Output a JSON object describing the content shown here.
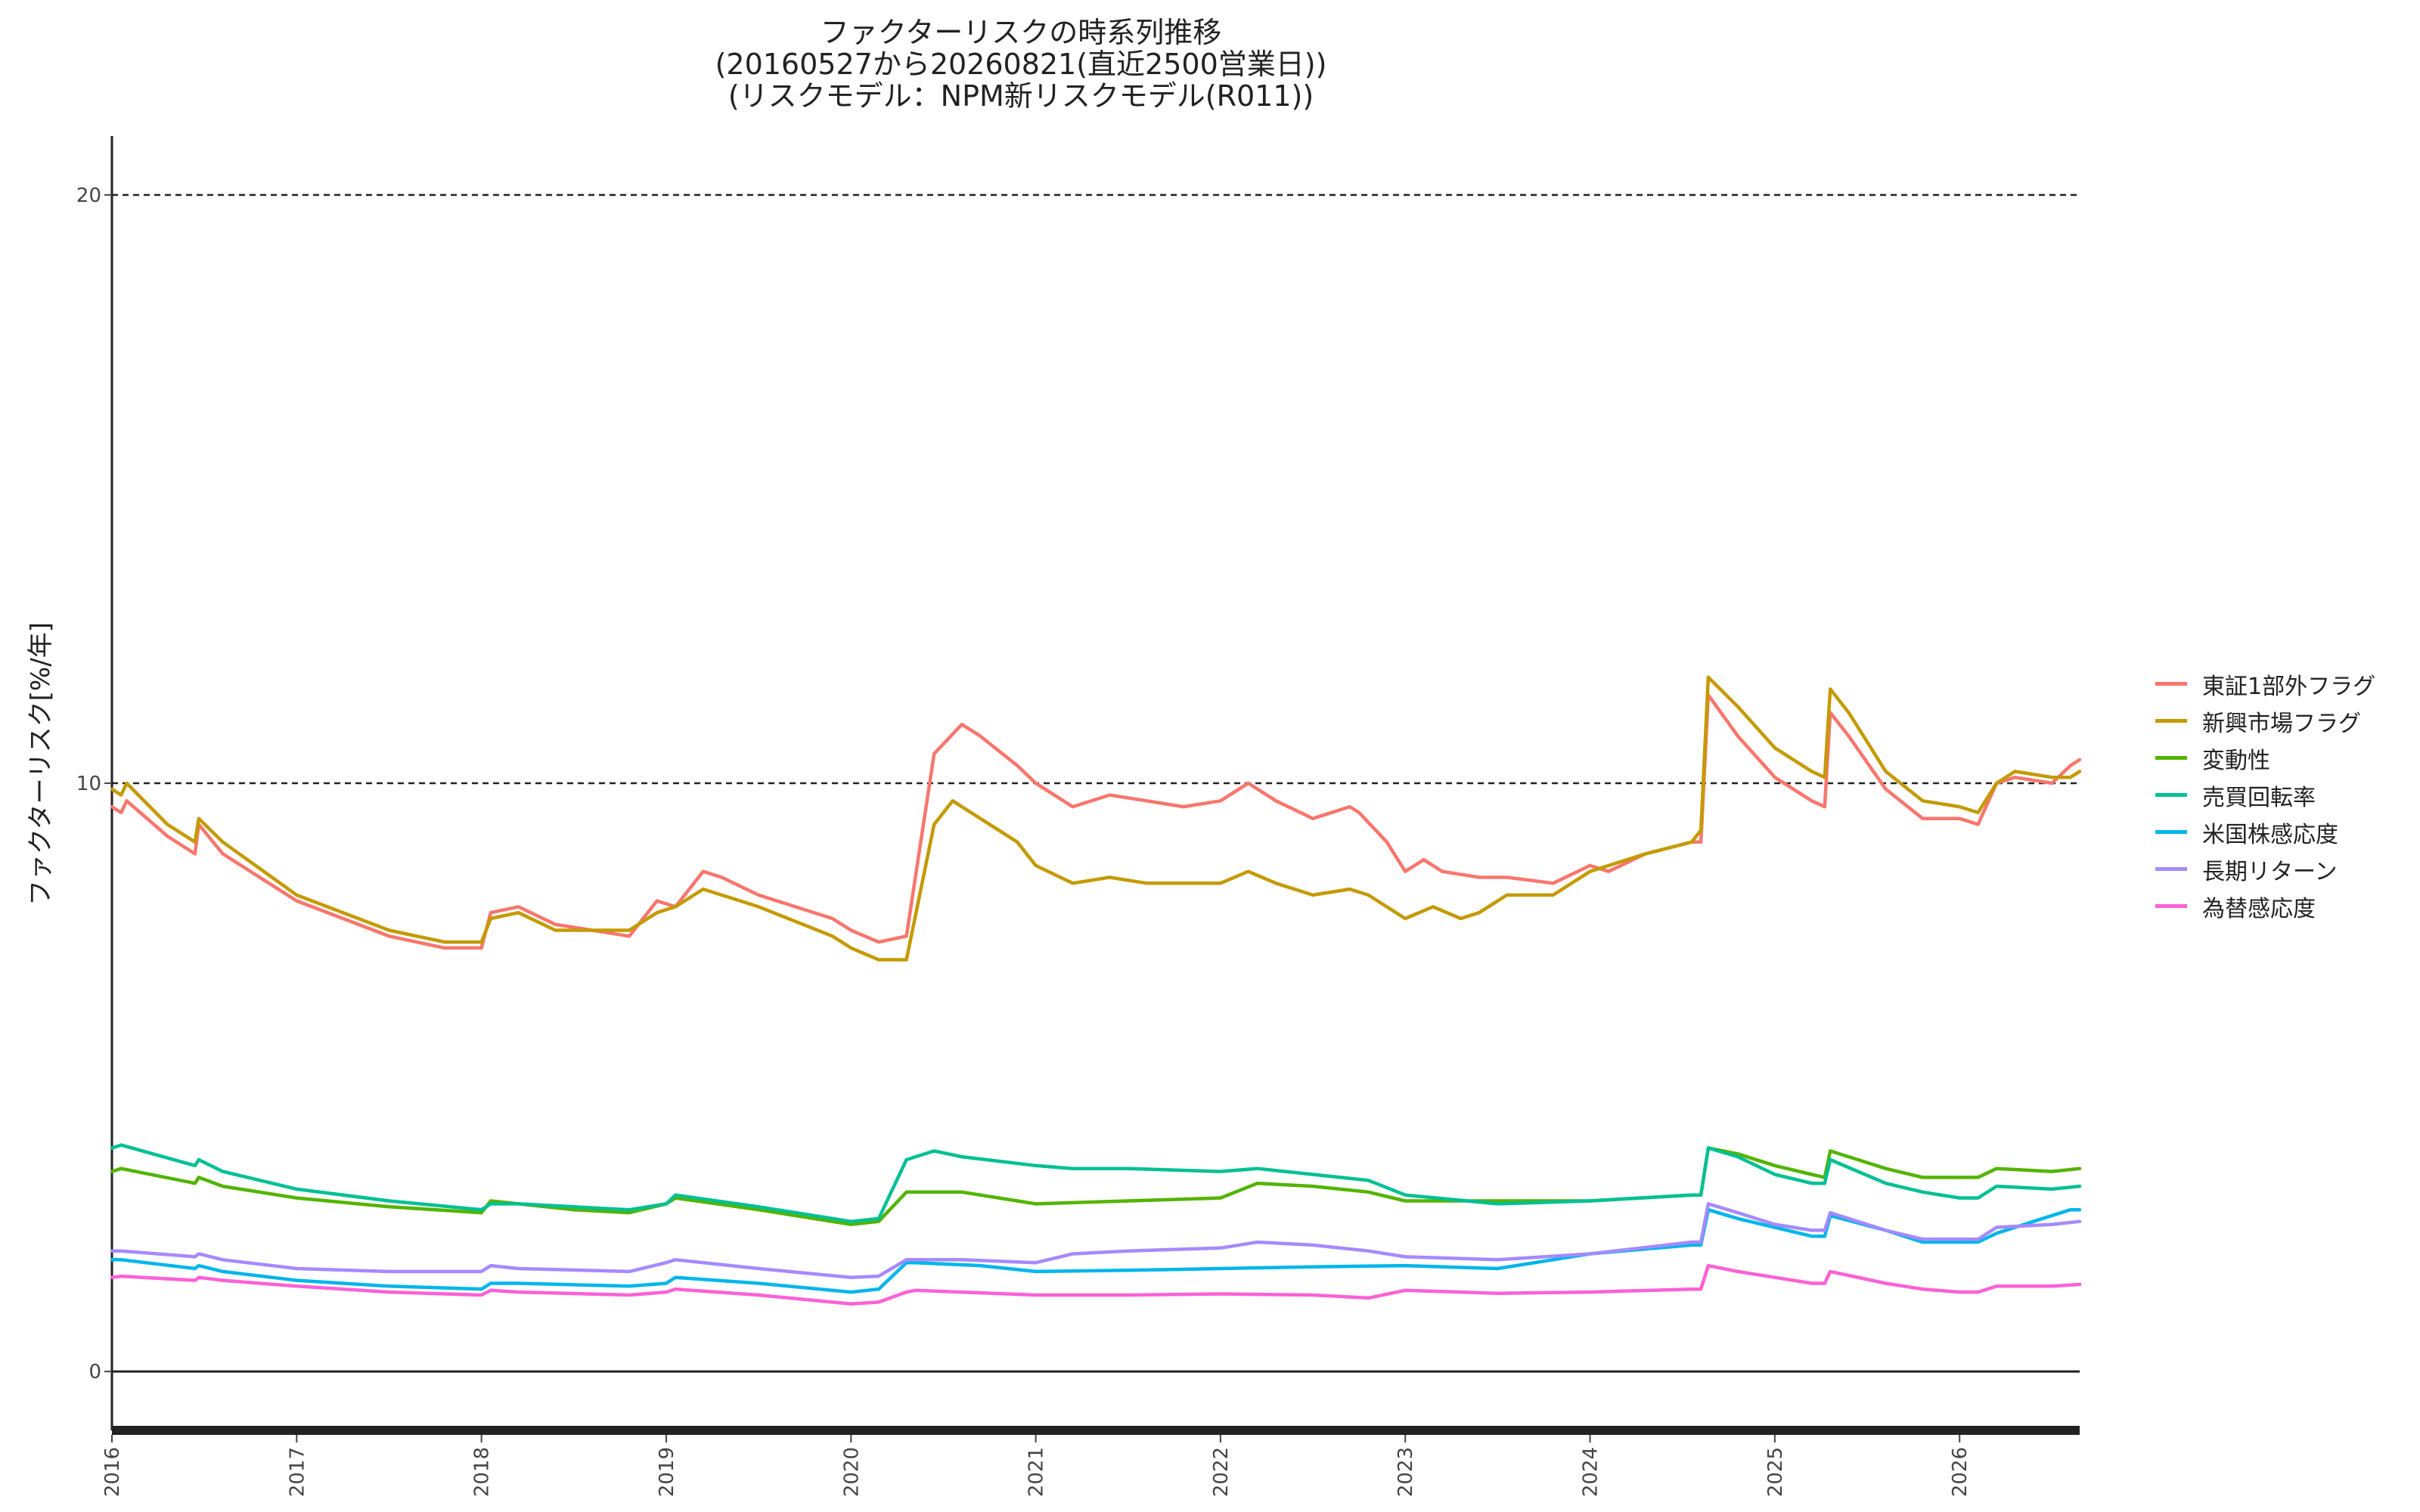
{
  "chart_data": {
    "type": "line",
    "title_lines": [
      "ファクターリスクの時系列推移",
      "(20160527から20260821(直近2500営業日))",
      "(リスクモデル：NPM新リスクモデル(R011))"
    ],
    "ylabel": "ファクターリスク[%/年]",
    "xlabel": "",
    "xlim": [
      2016.0,
      2026.65
    ],
    "ylim": [
      -1.0,
      21.0
    ],
    "x_ticks": [
      "2016",
      "2017",
      "2018",
      "2019",
      "2020",
      "2021",
      "2022",
      "2023",
      "2024",
      "2025",
      "2026"
    ],
    "y_ticks": [
      0,
      10,
      20
    ],
    "reference_lines": [
      10,
      20
    ],
    "legend_position": "right",
    "series": [
      {
        "name": "東証1部外フラグ",
        "color": "#F8766D",
        "x": [
          2016.0,
          2016.05,
          2016.08,
          2016.3,
          2016.45,
          2016.47,
          2016.6,
          2017.0,
          2017.5,
          2017.8,
          2018.0,
          2018.05,
          2018.2,
          2018.4,
          2018.8,
          2018.95,
          2019.05,
          2019.2,
          2019.3,
          2019.5,
          2019.9,
          2020.0,
          2020.15,
          2020.3,
          2020.45,
          2020.6,
          2020.7,
          2020.9,
          2021.0,
          2021.2,
          2021.4,
          2021.6,
          2021.8,
          2022.0,
          2022.15,
          2022.3,
          2022.5,
          2022.7,
          2022.75,
          2022.9,
          2023.0,
          2023.1,
          2023.2,
          2023.4,
          2023.55,
          2023.8,
          2024.0,
          2024.1,
          2024.3,
          2024.55,
          2024.6,
          2024.64,
          2024.8,
          2025.0,
          2025.2,
          2025.27,
          2025.3,
          2025.4,
          2025.6,
          2025.8,
          2026.0,
          2026.1,
          2026.2,
          2026.3,
          2026.5,
          2026.6,
          2026.65
        ],
        "y": [
          9.6,
          9.5,
          9.7,
          9.1,
          8.8,
          9.3,
          8.8,
          8.0,
          7.4,
          7.2,
          7.2,
          7.8,
          7.9,
          7.6,
          7.4,
          8.0,
          7.9,
          8.5,
          8.4,
          8.1,
          7.7,
          7.5,
          7.3,
          7.4,
          10.5,
          11.0,
          10.8,
          10.3,
          10.0,
          9.6,
          9.8,
          9.7,
          9.6,
          9.7,
          10.0,
          9.7,
          9.4,
          9.6,
          9.5,
          9.0,
          8.5,
          8.7,
          8.5,
          8.4,
          8.4,
          8.3,
          8.6,
          8.5,
          8.8,
          9.0,
          9.0,
          11.5,
          10.8,
          10.1,
          9.7,
          9.6,
          11.2,
          10.8,
          9.9,
          9.4,
          9.4,
          9.3,
          10.0,
          10.1,
          10.0,
          10.3,
          10.4
        ]
      },
      {
        "name": "新興市場フラグ",
        "color": "#C49A00",
        "x": [
          2016.0,
          2016.05,
          2016.08,
          2016.3,
          2016.45,
          2016.47,
          2016.6,
          2017.0,
          2017.5,
          2017.8,
          2018.0,
          2018.05,
          2018.2,
          2018.4,
          2018.8,
          2018.95,
          2019.05,
          2019.2,
          2019.5,
          2019.9,
          2020.0,
          2020.15,
          2020.3,
          2020.45,
          2020.55,
          2020.7,
          2020.9,
          2021.0,
          2021.2,
          2021.4,
          2021.6,
          2021.8,
          2022.0,
          2022.15,
          2022.3,
          2022.5,
          2022.7,
          2022.8,
          2023.0,
          2023.15,
          2023.3,
          2023.4,
          2023.55,
          2023.8,
          2024.0,
          2024.3,
          2024.55,
          2024.6,
          2024.64,
          2024.8,
          2025.0,
          2025.2,
          2025.27,
          2025.3,
          2025.4,
          2025.6,
          2025.8,
          2026.0,
          2026.1,
          2026.2,
          2026.3,
          2026.5,
          2026.6,
          2026.65
        ],
        "y": [
          9.9,
          9.8,
          10.0,
          9.3,
          9.0,
          9.4,
          9.0,
          8.1,
          7.5,
          7.3,
          7.3,
          7.7,
          7.8,
          7.5,
          7.5,
          7.8,
          7.9,
          8.2,
          7.9,
          7.4,
          7.2,
          7.0,
          7.0,
          9.3,
          9.7,
          9.4,
          9.0,
          8.6,
          8.3,
          8.4,
          8.3,
          8.3,
          8.3,
          8.5,
          8.3,
          8.1,
          8.2,
          8.1,
          7.7,
          7.9,
          7.7,
          7.8,
          8.1,
          8.1,
          8.5,
          8.8,
          9.0,
          9.2,
          11.8,
          11.3,
          10.6,
          10.2,
          10.1,
          11.6,
          11.2,
          10.2,
          9.7,
          9.6,
          9.5,
          10.0,
          10.2,
          10.1,
          10.1,
          10.2
        ]
      },
      {
        "name": "変動性",
        "color": "#53B400",
        "x": [
          2016.0,
          2016.05,
          2016.45,
          2016.47,
          2016.6,
          2017.0,
          2017.5,
          2018.0,
          2018.05,
          2018.2,
          2018.5,
          2018.8,
          2019.0,
          2019.05,
          2019.5,
          2020.0,
          2020.15,
          2020.3,
          2020.6,
          2021.0,
          2021.5,
          2022.0,
          2022.2,
          2022.5,
          2022.8,
          2023.0,
          2023.5,
          2024.0,
          2024.55,
          2024.6,
          2024.64,
          2024.8,
          2025.0,
          2025.2,
          2025.27,
          2025.3,
          2025.6,
          2025.8,
          2026.0,
          2026.1,
          2026.2,
          2026.5,
          2026.65
        ],
        "y": [
          3.4,
          3.45,
          3.2,
          3.3,
          3.15,
          2.95,
          2.8,
          2.7,
          2.9,
          2.85,
          2.75,
          2.7,
          2.85,
          2.95,
          2.75,
          2.5,
          2.55,
          3.05,
          3.05,
          2.85,
          2.9,
          2.95,
          3.2,
          3.15,
          3.05,
          2.9,
          2.9,
          2.9,
          3.0,
          3.0,
          3.8,
          3.7,
          3.5,
          3.35,
          3.3,
          3.75,
          3.45,
          3.3,
          3.3,
          3.3,
          3.45,
          3.4,
          3.45
        ]
      },
      {
        "name": "売買回転率",
        "color": "#00C094",
        "x": [
          2016.0,
          2016.05,
          2016.45,
          2016.47,
          2016.6,
          2017.0,
          2017.5,
          2018.0,
          2018.05,
          2018.2,
          2018.5,
          2018.8,
          2019.0,
          2019.05,
          2019.5,
          2020.0,
          2020.15,
          2020.3,
          2020.45,
          2020.6,
          2021.0,
          2021.2,
          2021.5,
          2022.0,
          2022.2,
          2022.5,
          2022.8,
          2023.0,
          2023.5,
          2024.0,
          2024.55,
          2024.6,
          2024.64,
          2024.8,
          2025.0,
          2025.2,
          2025.27,
          2025.3,
          2025.6,
          2025.8,
          2026.0,
          2026.1,
          2026.2,
          2026.5,
          2026.65
        ],
        "y": [
          3.8,
          3.85,
          3.5,
          3.6,
          3.4,
          3.1,
          2.9,
          2.75,
          2.85,
          2.85,
          2.8,
          2.75,
          2.85,
          3.0,
          2.8,
          2.55,
          2.6,
          3.6,
          3.75,
          3.65,
          3.5,
          3.45,
          3.45,
          3.4,
          3.45,
          3.35,
          3.25,
          3.0,
          2.85,
          2.9,
          3.0,
          3.0,
          3.8,
          3.65,
          3.35,
          3.2,
          3.2,
          3.6,
          3.2,
          3.05,
          2.95,
          2.95,
          3.15,
          3.1,
          3.15
        ]
      },
      {
        "name": "米国株感応度",
        "color": "#00B6EB",
        "x": [
          2016.0,
          2016.05,
          2016.45,
          2016.47,
          2016.6,
          2017.0,
          2017.5,
          2018.0,
          2018.05,
          2018.2,
          2018.8,
          2019.0,
          2019.05,
          2019.5,
          2020.0,
          2020.15,
          2020.3,
          2020.35,
          2020.7,
          2021.0,
          2021.5,
          2022.0,
          2022.5,
          2023.0,
          2023.5,
          2024.0,
          2024.55,
          2024.6,
          2024.64,
          2024.8,
          2025.0,
          2025.2,
          2025.27,
          2025.3,
          2025.6,
          2025.8,
          2026.0,
          2026.1,
          2026.2,
          2026.4,
          2026.6,
          2026.65
        ],
        "y": [
          1.9,
          1.9,
          1.75,
          1.8,
          1.7,
          1.55,
          1.45,
          1.4,
          1.5,
          1.5,
          1.45,
          1.5,
          1.6,
          1.5,
          1.35,
          1.4,
          1.85,
          1.85,
          1.8,
          1.7,
          1.72,
          1.75,
          1.78,
          1.8,
          1.75,
          2.0,
          2.15,
          2.15,
          2.75,
          2.6,
          2.45,
          2.3,
          2.3,
          2.65,
          2.4,
          2.2,
          2.2,
          2.2,
          2.35,
          2.55,
          2.75,
          2.75
        ]
      },
      {
        "name": "長期リターン",
        "color": "#A58AFF",
        "x": [
          2016.0,
          2016.05,
          2016.45,
          2016.47,
          2016.6,
          2017.0,
          2017.5,
          2018.0,
          2018.05,
          2018.2,
          2018.8,
          2019.0,
          2019.05,
          2019.5,
          2020.0,
          2020.15,
          2020.3,
          2020.35,
          2020.6,
          2021.0,
          2021.2,
          2021.5,
          2022.0,
          2022.2,
          2022.5,
          2022.8,
          2023.0,
          2023.5,
          2024.0,
          2024.55,
          2024.6,
          2024.64,
          2024.8,
          2025.0,
          2025.2,
          2025.27,
          2025.3,
          2025.6,
          2025.8,
          2026.0,
          2026.1,
          2026.2,
          2026.5,
          2026.65
        ],
        "y": [
          2.05,
          2.05,
          1.95,
          2.0,
          1.9,
          1.75,
          1.7,
          1.7,
          1.8,
          1.75,
          1.7,
          1.85,
          1.9,
          1.75,
          1.6,
          1.62,
          1.9,
          1.9,
          1.9,
          1.85,
          2.0,
          2.05,
          2.1,
          2.2,
          2.15,
          2.05,
          1.95,
          1.9,
          2.0,
          2.2,
          2.2,
          2.85,
          2.7,
          2.5,
          2.4,
          2.4,
          2.7,
          2.4,
          2.25,
          2.25,
          2.25,
          2.45,
          2.5,
          2.55
        ]
      },
      {
        "name": "為替感応度",
        "color": "#FB61D7",
        "x": [
          2016.0,
          2016.05,
          2016.45,
          2016.47,
          2016.6,
          2017.0,
          2017.5,
          2018.0,
          2018.05,
          2018.2,
          2018.8,
          2019.0,
          2019.05,
          2019.5,
          2020.0,
          2020.15,
          2020.3,
          2020.35,
          2020.6,
          2021.0,
          2021.5,
          2022.0,
          2022.5,
          2022.8,
          2023.0,
          2023.5,
          2024.0,
          2024.55,
          2024.6,
          2024.64,
          2024.8,
          2025.0,
          2025.2,
          2025.27,
          2025.3,
          2025.6,
          2025.8,
          2026.0,
          2026.1,
          2026.2,
          2026.5,
          2026.65
        ],
        "y": [
          1.6,
          1.62,
          1.55,
          1.6,
          1.55,
          1.45,
          1.35,
          1.3,
          1.38,
          1.35,
          1.3,
          1.35,
          1.4,
          1.3,
          1.15,
          1.18,
          1.35,
          1.38,
          1.35,
          1.3,
          1.3,
          1.32,
          1.3,
          1.25,
          1.38,
          1.33,
          1.35,
          1.4,
          1.4,
          1.8,
          1.7,
          1.6,
          1.5,
          1.5,
          1.7,
          1.5,
          1.4,
          1.35,
          1.35,
          1.45,
          1.45,
          1.48
        ]
      }
    ]
  }
}
